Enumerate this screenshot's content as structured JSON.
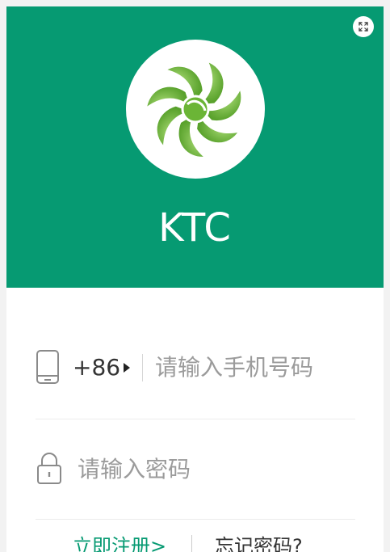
{
  "header": {
    "app_name": "KTC",
    "brand_color": "#069a72",
    "logo_color": "#5fae2c",
    "expand_icon": "expand-icon"
  },
  "login_form": {
    "phone": {
      "icon": "mobile-phone-icon",
      "country_code": "+86",
      "placeholder": "请输入手机号码",
      "value": ""
    },
    "password": {
      "icon": "lock-icon",
      "placeholder": "请输入密码",
      "value": ""
    }
  },
  "footer": {
    "register_label": "立即注册>",
    "forgot_label": "忘记密码?"
  }
}
